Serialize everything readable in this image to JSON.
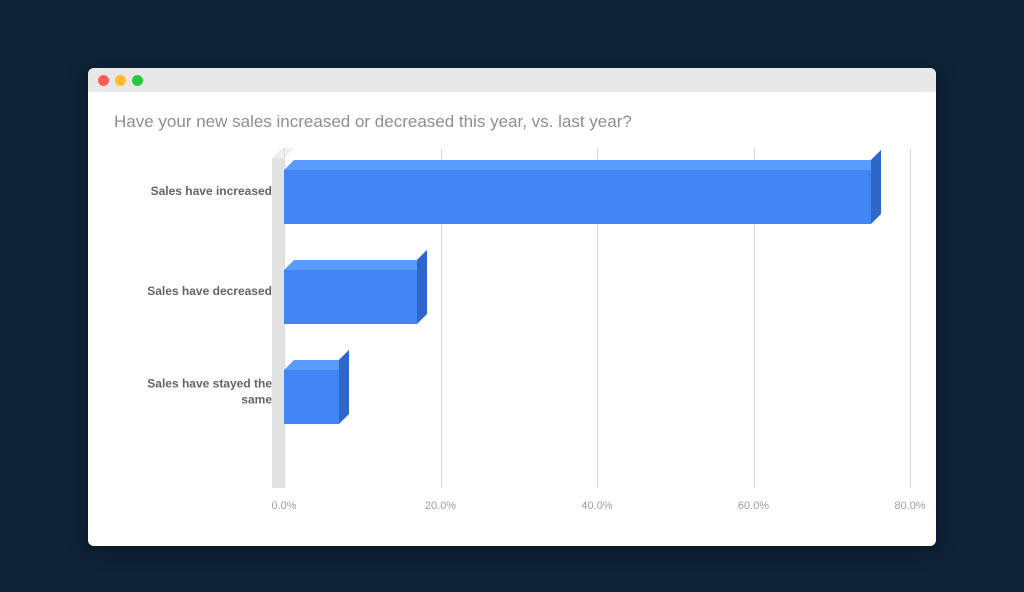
{
  "window": {
    "traffic_lights": [
      "close",
      "minimize",
      "zoom"
    ]
  },
  "chart_data": {
    "type": "bar",
    "orientation": "horizontal",
    "title": "Have your new sales increased or decreased this year, vs. last year?",
    "categories": [
      "Sales have increased",
      "Sales have decreased",
      "Sales have stayed the same"
    ],
    "values": [
      75,
      17,
      7
    ],
    "value_format": "percent",
    "xlabel": "",
    "ylabel": "",
    "xlim": [
      0,
      80
    ],
    "x_ticks": [
      0,
      20,
      40,
      60,
      80
    ],
    "x_tick_labels": [
      "0.0%",
      "20.0%",
      "40.0%",
      "60.0%",
      "80.0%"
    ],
    "grid": {
      "x": true,
      "y": false
    },
    "style_3d": true,
    "colors": {
      "bar": "#4285f4",
      "bar_top": "#5a9bff",
      "bar_side": "#2f66c9"
    }
  }
}
